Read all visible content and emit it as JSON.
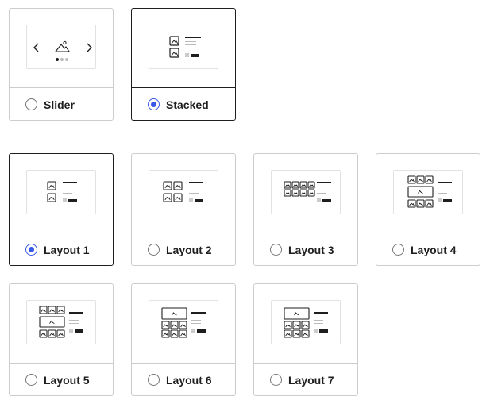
{
  "colors": {
    "accent": "#3858e9",
    "border": "#cccccc",
    "selected_border": "#1e1e1e",
    "text": "#1e1e1e"
  },
  "top_options": [
    {
      "label": "Slider",
      "selected": false,
      "preview": "slider"
    },
    {
      "label": "Stacked",
      "selected": true,
      "preview": "stacked"
    }
  ],
  "layout_options": [
    {
      "label": "Layout 1",
      "selected": true,
      "preview": "layout-1"
    },
    {
      "label": "Layout 2",
      "selected": false,
      "preview": "layout-2"
    },
    {
      "label": "Layout 3",
      "selected": false,
      "preview": "layout-3"
    },
    {
      "label": "Layout 4",
      "selected": false,
      "preview": "layout-4"
    },
    {
      "label": "Layout 5",
      "selected": false,
      "preview": "layout-5"
    },
    {
      "label": "Layout 6",
      "selected": false,
      "preview": "layout-6"
    },
    {
      "label": "Layout 7",
      "selected": false,
      "preview": "layout-7"
    }
  ]
}
